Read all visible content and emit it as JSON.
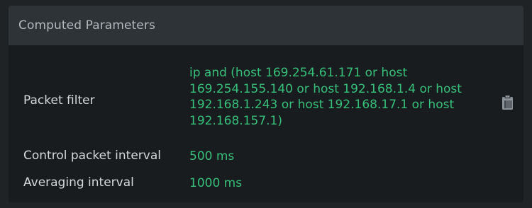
{
  "panel": {
    "title": "Computed Parameters"
  },
  "params": {
    "packet_filter": {
      "label": "Packet filter",
      "value": "ip and (host 169.254.61.171 or host 169.254.155.140 or host 192.168.1.4 or host 192.168.1.243 or host 192.168.17.1 or host 192.168.157.1)",
      "copy_icon": "clipboard-icon"
    },
    "control_interval": {
      "label": "Control packet interval",
      "value": "500 ms"
    },
    "averaging_interval": {
      "label": "Averaging interval",
      "value": "1000 ms"
    }
  },
  "colors": {
    "value_green": "#36c07a",
    "label_text": "#d6d9dc",
    "header_bg": "#2e3338",
    "panel_bg": "#191c1f"
  }
}
